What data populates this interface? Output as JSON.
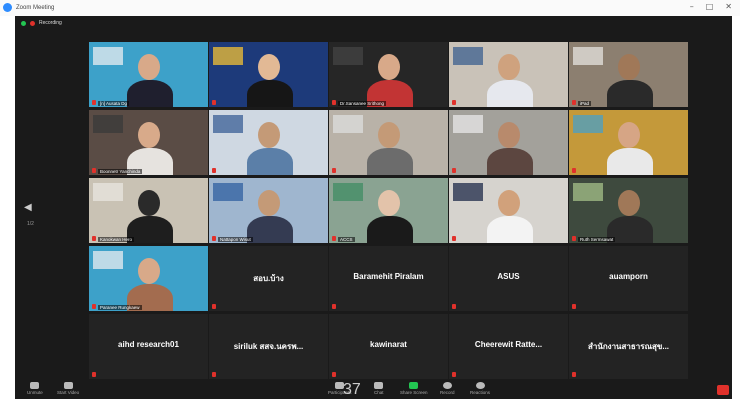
{
  "window": {
    "title": "Zoom Meeting"
  },
  "topbar": {
    "recording_label": "Recording"
  },
  "nav": {
    "page": "1/2"
  },
  "tiles": [
    {
      "name": "",
      "label": "[n] Ausata Dg"
    },
    {
      "name": "",
      "label": ""
    },
    {
      "name": "",
      "label": "Dr.Sansanee Srithong"
    },
    {
      "name": "",
      "label": ""
    },
    {
      "name": "",
      "label": "iPad"
    },
    {
      "name": "",
      "label": "Boonnetr Yanchinda"
    },
    {
      "name": "",
      "label": ""
    },
    {
      "name": "",
      "label": ""
    },
    {
      "name": "",
      "label": ""
    },
    {
      "name": "",
      "label": ""
    },
    {
      "name": "",
      "label": "Kanokwan Hero"
    },
    {
      "name": "",
      "label": "Nattapon Wisut"
    },
    {
      "name": "",
      "label": "ACCS"
    },
    {
      "name": "",
      "label": ""
    },
    {
      "name": "",
      "label": "Ruth Sermsawat"
    },
    {
      "name": "",
      "label": "Paranee Rungkaew"
    },
    {
      "name": "สอบ.บ้าง",
      "label": ""
    },
    {
      "name": "Baramehit Piralam",
      "label": ""
    },
    {
      "name": "ASUS",
      "label": ""
    },
    {
      "name": "auamporn",
      "label": ""
    },
    {
      "name": "aihd research01",
      "label": ""
    },
    {
      "name": "siriluk สสจ.นครพ...",
      "label": ""
    },
    {
      "name": "kawinarat",
      "label": ""
    },
    {
      "name": "Cheerewit Ratte...",
      "label": ""
    },
    {
      "name": "สำนักงานสาธารณสุข...",
      "label": ""
    }
  ],
  "toolbar": {
    "unmute": "Unmute",
    "start_video": "Start Video",
    "participants": "Participants",
    "participant_count": "37",
    "chat": "Chat",
    "share_screen": "Share Screen",
    "record": "Record",
    "reactions": "Reactions"
  },
  "colors": {
    "active_speaker": "#b6e35e",
    "share_green": "#23c552",
    "end_red": "#e0312b"
  }
}
